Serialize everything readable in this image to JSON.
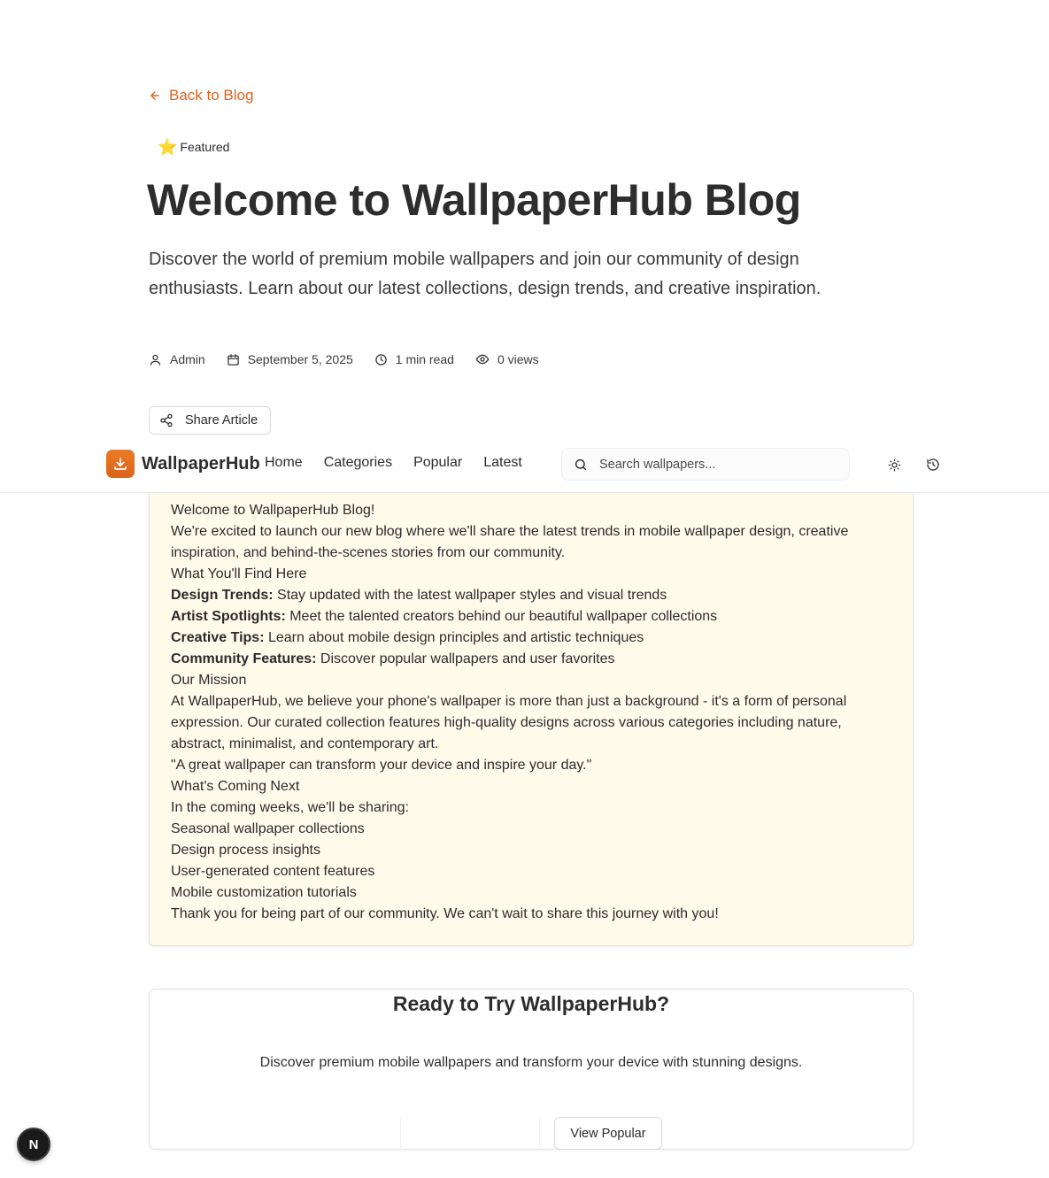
{
  "back_link": {
    "label": "Back to Blog",
    "color": "#e0601e"
  },
  "badge": {
    "icon": "star-emoji",
    "emoji": "⭐",
    "label": "Featured"
  },
  "article": {
    "title": "Welcome to WallpaperHub Blog",
    "lede": "Discover the world of premium mobile wallpapers and join our community of design enthusiasts. Learn about our latest collections, design trends, and creative inspiration.",
    "meta": {
      "author": "Admin",
      "date": "September 5, 2025",
      "read_time": "1 min read",
      "views": "0 views"
    },
    "share_label": "Share Article"
  },
  "navbar": {
    "brand": "WallpaperHub",
    "brand_color": "#e8731f",
    "links": [
      "Home",
      "Categories",
      "Popular",
      "Latest"
    ],
    "search_placeholder": "Search wallpapers...",
    "icons": [
      "sun-icon",
      "history-icon"
    ]
  },
  "content": {
    "heading": "Welcome to WallpaperHub Blog!",
    "intro": "We're excited to launch our new blog where we'll share the latest trends in mobile wallpaper design, creative inspiration, and behind-the-scenes stories from our community.",
    "find_heading": "What You'll Find Here",
    "features": [
      {
        "term": "Design Trends:",
        "text": " Stay updated with the latest wallpaper styles and visual trends"
      },
      {
        "term": "Artist Spotlights:",
        "text": " Meet the talented creators behind our beautiful wallpaper collections"
      },
      {
        "term": "Creative Tips:",
        "text": " Learn about mobile design principles and artistic techniques"
      },
      {
        "term": "Community Features:",
        "text": " Discover popular wallpapers and user favorites"
      }
    ],
    "mission_heading": "Our Mission",
    "mission": "At WallpaperHub, we believe your phone's wallpaper is more than just a background - it's a form of personal expression. Our curated collection features high-quality designs across various categories including nature, abstract, minimalist, and contemporary art.",
    "quote": "\"A great wallpaper can transform your device and inspire your day.\"",
    "next_heading": "What's Coming Next",
    "next_intro": "In the coming weeks, we'll be sharing:",
    "next_items": [
      "Seasonal wallpaper collections",
      "Design process insights",
      "User-generated content features",
      "Mobile customization tutorials"
    ],
    "closing": "Thank you for being part of our community. We can't wait to share this journey with you!",
    "background": "#fffbeb"
  },
  "cta": {
    "title": "Ready to Try WallpaperHub?",
    "text": "Discover premium mobile wallpapers and transform your device with stunning designs.",
    "button": "View Popular"
  },
  "dev_badge": {
    "letter": "N"
  }
}
